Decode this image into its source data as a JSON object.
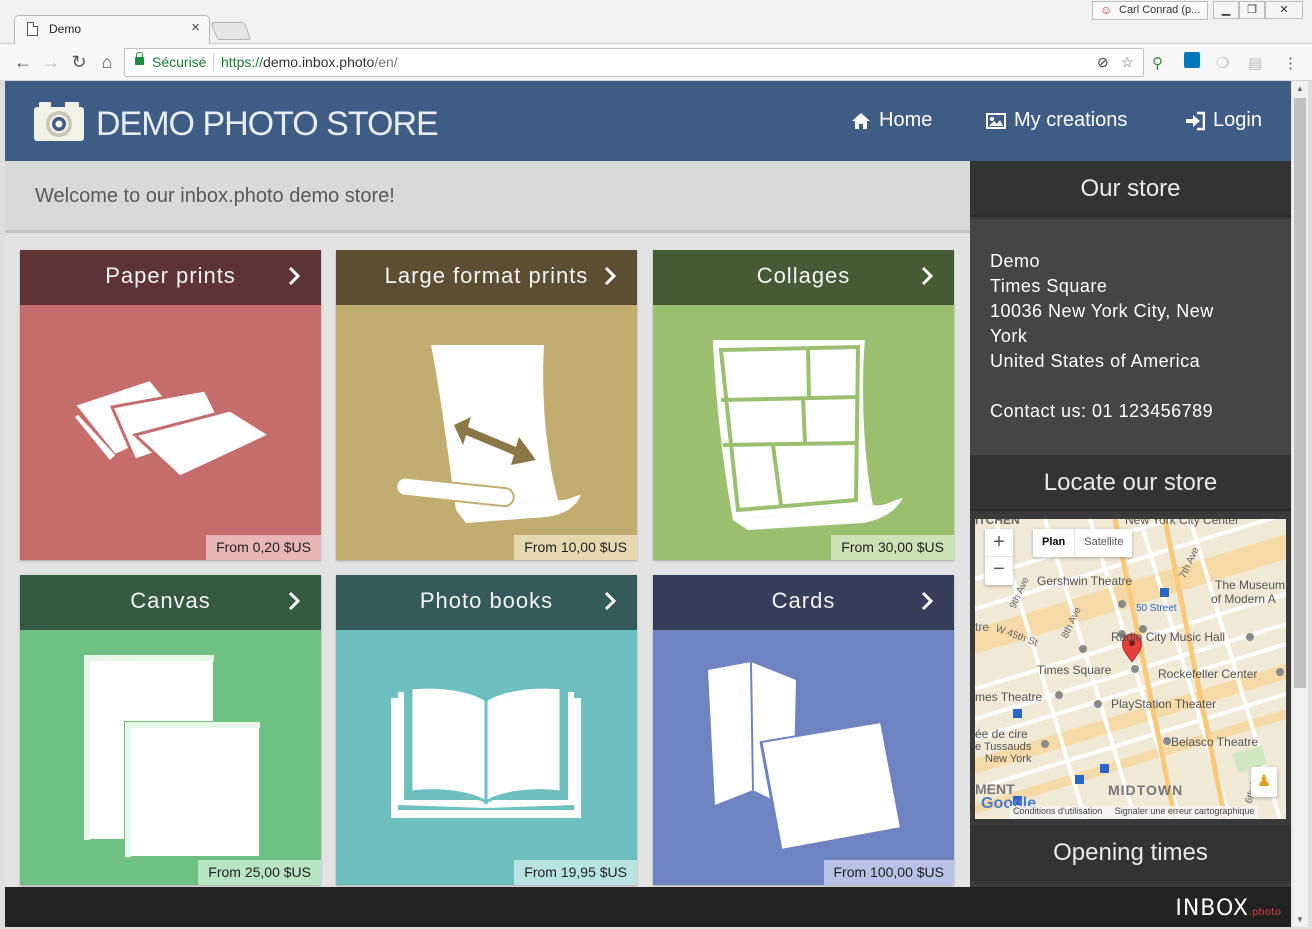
{
  "browser": {
    "tab_title": "Demo",
    "tab_close": "×",
    "user_name": "Carl Conrad (p...",
    "secure_label": "Sécurisé",
    "url_scheme": "https://",
    "url_host": "demo.inbox.photo",
    "url_path": "/en/"
  },
  "header": {
    "brand": "DEMO PHOTO STORE",
    "nav": [
      {
        "label": "Home",
        "icon": "home-icon"
      },
      {
        "label": "My creations",
        "icon": "image-icon"
      },
      {
        "label": "Login",
        "icon": "sign-in-icon"
      }
    ]
  },
  "welcome": "Welcome to our inbox.photo demo store!",
  "products": [
    {
      "title": "Paper prints",
      "price": "From 0,20 $US",
      "head_color": "#5d3335",
      "body_color": "#c56d6d",
      "price_bg": "#e8b6b6"
    },
    {
      "title": "Large format prints",
      "price": "From 10,00 $US",
      "head_color": "#5c4e33",
      "body_color": "#c2ad70",
      "price_bg": "#e6d8ae"
    },
    {
      "title": "Collages",
      "price": "From 30,00 $US",
      "head_color": "#465a35",
      "body_color": "#9ac06f",
      "price_bg": "#cde2b4"
    },
    {
      "title": "Canvas",
      "price": "From 25,00 $US",
      "head_color": "#355a40",
      "body_color": "#6ec183",
      "price_bg": "#b7e4c2"
    },
    {
      "title": "Photo books",
      "price": "From 19,95 $US",
      "head_color": "#355a5a",
      "body_color": "#6ec0c0",
      "price_bg": "#b8e3e3"
    },
    {
      "title": "Cards",
      "price": "From 100,00 $US",
      "head_color": "#353d5a",
      "body_color": "#6f82c2",
      "price_bg": "#b8c1e6"
    }
  ],
  "sidebar": {
    "store_title": "Our store",
    "address_lines": [
      "Demo",
      "Times Square",
      "10036 New York City, New",
      "York",
      "United States of America"
    ],
    "contact": "Contact us: 01 123456789",
    "locate_title": "Locate our store",
    "opening_title": "Opening times"
  },
  "map": {
    "zoom_in": "+",
    "zoom_out": "−",
    "type_plan": "Plan",
    "type_satellite": "Satellite",
    "labels": [
      "Gershwin Theatre",
      "The Museum",
      "of Modern A",
      "50 Street",
      "Radio City Music Hall",
      "W 45th St",
      "Times Square",
      "Rockefeller Center",
      "mes Theatre",
      "PlayStation Theater",
      "ée de cire",
      "e Tussauds",
      "New York",
      "Belasco Theatre",
      "MIDTOWN",
      "MENT",
      "ITCHEN",
      "New York City Center",
      "9th Ave",
      "8th Ave",
      "7th Ave",
      "6th Ave",
      "tre"
    ],
    "terms": "Conditions d'utilisation",
    "report": "Signaler une erreur cartographique",
    "google": "Google"
  },
  "footer": {
    "logo": "INBOX",
    "logo_suffix": ".photo"
  }
}
